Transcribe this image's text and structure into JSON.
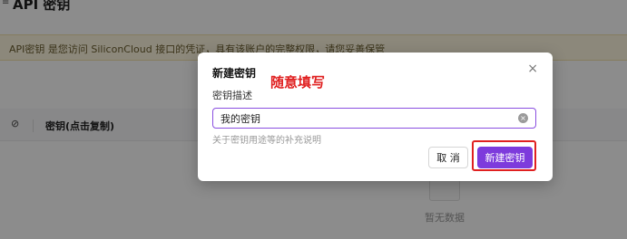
{
  "page": {
    "title": "API 密钥",
    "notice": "API密钥 是您访问 SiliconCloud 接口的凭证，具有该账户的完整权限，请您妥善保管",
    "table": {
      "column_key": "密钥(点击复制)"
    },
    "empty_text": "暂无数据"
  },
  "modal": {
    "title": "新建密钥",
    "annotation": "随意填写",
    "field_label": "密钥描述",
    "input_value": "我的密钥",
    "help_text": "关于密钥用途等的补充说明",
    "cancel_label": "取 消",
    "create_label": "新建密钥",
    "close_symbol": "×"
  },
  "colors": {
    "accent": "#7d3bdc",
    "annotation": "#e02020"
  }
}
